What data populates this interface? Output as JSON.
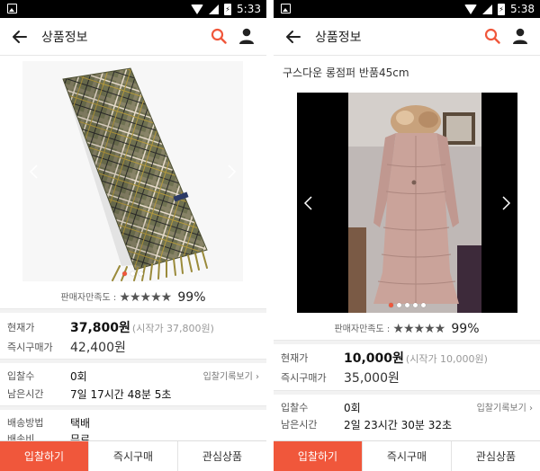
{
  "status_left": {
    "clock": "5:33"
  },
  "status_right": {
    "clock": "5:38"
  },
  "left": {
    "title": "상품정보",
    "seller_rating_label": "판매자만족도 :",
    "stars": "★★★★★",
    "rating_pct": "99%",
    "current_price_label": "현재가",
    "current_price": "37,800원",
    "start_price": "(시작가 37,800원)",
    "buy_now_label": "즉시구매가",
    "buy_now_price": "42,400원",
    "bids_label": "입찰수",
    "bids": "0회",
    "bid_history_link": "입찰기록보기",
    "time_left_label": "남은시간",
    "time_left": "7일 17시간 48분 5초",
    "shipping_method_label": "배송방법",
    "shipping_method": "택배",
    "shipping_cost_label": "배송비",
    "shipping_cost": "무료",
    "buttons": {
      "bid": "입찰하기",
      "buy_now": "즉시구매",
      "watch": "관심상품"
    }
  },
  "right": {
    "title": "상품정보",
    "product_name": "구스다운 롱점퍼 반품45cm",
    "seller_rating_label": "판매자만족도 :",
    "stars": "★★★★★",
    "rating_pct": "99%",
    "current_price_label": "현재가",
    "current_price": "10,000원",
    "start_price": "(시작가 10,000원)",
    "buy_now_label": "즉시구매가",
    "buy_now_price": "35,000원",
    "bids_label": "입찰수",
    "bids": "0회",
    "bid_history_link": "입찰기록보기",
    "time_left_label": "남은시간",
    "time_left": "2일 23시간 30분 32초",
    "buttons": {
      "bid": "입찰하기",
      "buy_now": "즉시구매",
      "watch": "관심상품"
    }
  },
  "colors": {
    "accent": "#f0573b",
    "status_bar": "#000000"
  },
  "icons": [
    "back-arrow-icon",
    "search-icon",
    "user-icon",
    "wifi-icon",
    "signal-icon",
    "battery-icon",
    "star-icon",
    "chevron-left-icon",
    "chevron-right-icon"
  ]
}
